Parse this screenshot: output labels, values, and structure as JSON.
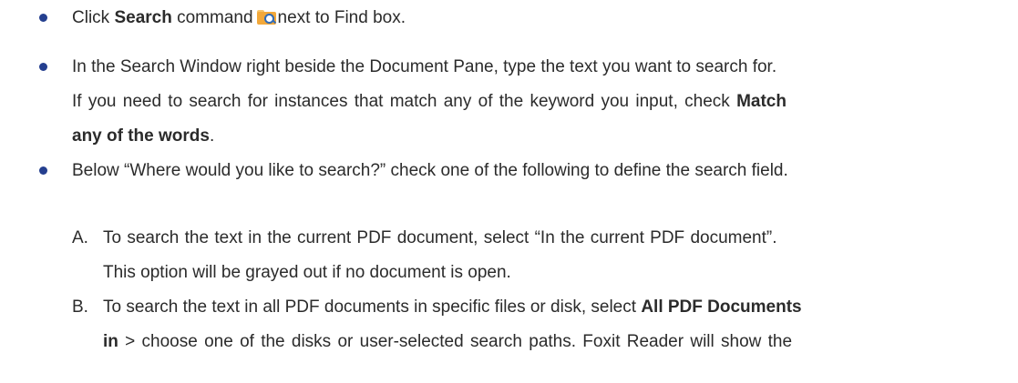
{
  "steps": {
    "s1": {
      "pre": "Click ",
      "bold": "Search",
      "mid": " command",
      "post": "next to Find box."
    },
    "s2": {
      "line1": "In the Search Window right beside the Document Pane, type the text you want to search for.",
      "line2_pre": "If you need to search for instances that match any of the keyword you input, check ",
      "line2_bold": "Match",
      "line3_bold": "any of the words",
      "line3_post": "."
    },
    "s3": {
      "line1": "Below “Where would you like to search?” check one of the following to define the search field."
    }
  },
  "options": {
    "a": {
      "marker": "A.",
      "line1": "To search the text in the current PDF document, select “In the current PDF document”.",
      "line2": "This option will be grayed out if no document is open."
    },
    "b": {
      "marker": "B.",
      "line1_pre": "To search the text in all PDF documents in specific files or disk, select ",
      "line1_bold": "All PDF Documents",
      "line2_bold": "in",
      "line2_post": " > choose one of the disks or user-selected search paths. Foxit Reader will show the"
    }
  },
  "colors": {
    "bullet": "#243f8f",
    "text": "#2b2b2b",
    "icon_folder": "#f2a83a",
    "icon_lens": "#2f6bb8"
  },
  "icons": {
    "bullet": "filled-circle",
    "search_command": "folder-magnifier-icon"
  }
}
